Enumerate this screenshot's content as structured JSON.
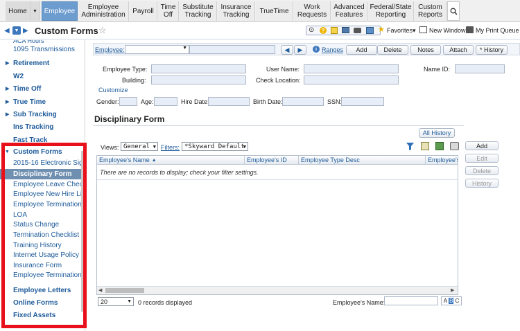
{
  "nav": {
    "tabs": [
      {
        "label": "Home"
      },
      {
        "label": "Employee"
      },
      {
        "label": "Employee Administration"
      },
      {
        "label": "Payroll"
      },
      {
        "label": "Time Off"
      },
      {
        "label": "Substitute Tracking"
      },
      {
        "label": "Insurance Tracking"
      },
      {
        "label": "TrueTime"
      },
      {
        "label": "Work Requests"
      },
      {
        "label": "Advanced Features"
      },
      {
        "label": "Federal/State Reporting"
      },
      {
        "label": "Custom Reports"
      }
    ]
  },
  "header": {
    "title": "Custom Forms",
    "favorites": "Favorites",
    "new_window": "New Window",
    "print_queue": "My Print Queue"
  },
  "sidebar": {
    "items": [
      {
        "label": "1095 Transmissions",
        "kind": "sub"
      },
      {
        "label": "Retirement",
        "kind": "sec"
      },
      {
        "label": "W2",
        "kind": "sec-plain"
      },
      {
        "label": "Time Off",
        "kind": "sec"
      },
      {
        "label": "True Time",
        "kind": "sec"
      },
      {
        "label": "Sub Tracking",
        "kind": "sec"
      },
      {
        "label": "Ins Tracking",
        "kind": "sec-plain"
      },
      {
        "label": "Fast Track",
        "kind": "sec-plain"
      },
      {
        "label": "Custom Forms",
        "kind": "open"
      },
      {
        "label": "2015-16 Electronic Sig",
        "kind": "sub"
      },
      {
        "label": "Disciplinary Form",
        "kind": "selected"
      },
      {
        "label": "Employee Leave Chec",
        "kind": "sub"
      },
      {
        "label": "Employee New Hire Lis",
        "kind": "sub"
      },
      {
        "label": "Employee Termination",
        "kind": "sub"
      },
      {
        "label": "LOA",
        "kind": "sub"
      },
      {
        "label": "Status Change",
        "kind": "sub"
      },
      {
        "label": "Termination Checklist -",
        "kind": "sub"
      },
      {
        "label": "Training History",
        "kind": "sub"
      },
      {
        "label": "Internet Usage Policy",
        "kind": "sub"
      },
      {
        "label": "Insurance Form",
        "kind": "sub"
      },
      {
        "label": "Employee Termination/",
        "kind": "sub"
      },
      {
        "label": "Employee Letters",
        "kind": "sec-plain"
      },
      {
        "label": "Online Forms",
        "kind": "sec-plain"
      },
      {
        "label": "Fixed Assets",
        "kind": "sec-plain"
      }
    ]
  },
  "toolbar": {
    "employee_label": "Employee:",
    "ranges": "Ranges",
    "add": "Add",
    "delete": "Delete",
    "notes": "Notes",
    "attach": "Attach",
    "history": "* History"
  },
  "filters": {
    "employee_type": "Employee Type:",
    "user_name": "User Name:",
    "name_id": "Name ID:",
    "building": "Building:",
    "check_location": "Check Location:",
    "customize": "Customize",
    "gender": "Gender:",
    "age": "Age:",
    "hire_date": "Hire Date:",
    "birth_date": "Birth Date:",
    "ssn": "SSN:"
  },
  "section": {
    "title": "Disciplinary Form",
    "all_history": "All History",
    "views_label": "Views:",
    "views_value": "General",
    "filters_label": "Filters:",
    "filters_value": "*Skyward Default"
  },
  "grid": {
    "columns": [
      "Employee's Name",
      "Employee's ID",
      "Employee Type Desc",
      "Employee's"
    ],
    "empty_message": "There are no records to display; check your filter settings.",
    "page_size": "20",
    "records": "0 records displayed",
    "search_label": "Employee's Name:"
  },
  "side_buttons": {
    "add": "Add",
    "edit": "Edit",
    "delete": "Delete",
    "history": "History"
  },
  "colors": {
    "accent": "#6d9ccf",
    "link": "#1e5b9a",
    "highlight": "#e8101b"
  }
}
